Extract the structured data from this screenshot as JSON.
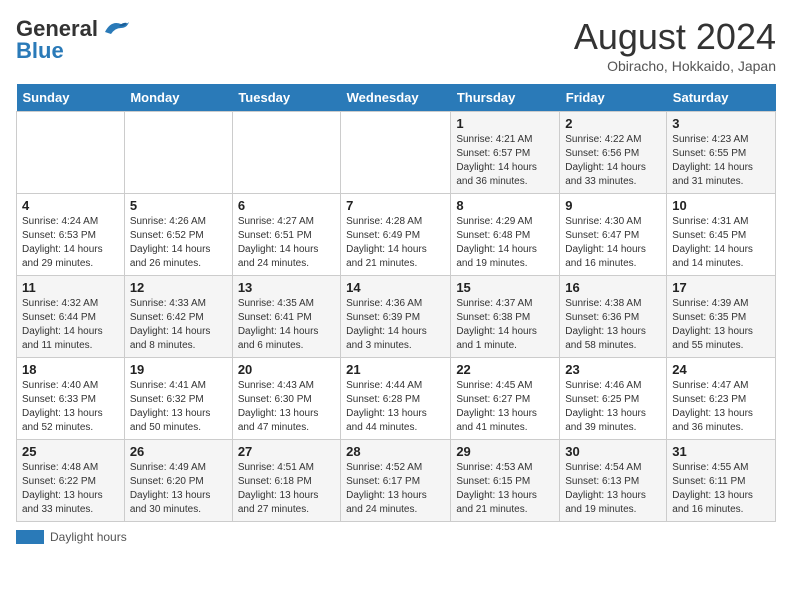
{
  "logo": {
    "line1": "General",
    "line2": "Blue"
  },
  "title": "August 2024",
  "subtitle": "Obiracho, Hokkaido, Japan",
  "weekdays": [
    "Sunday",
    "Monday",
    "Tuesday",
    "Wednesday",
    "Thursday",
    "Friday",
    "Saturday"
  ],
  "legend": {
    "box_label": "Daylight hours"
  },
  "weeks": [
    [
      {
        "day": "",
        "info": ""
      },
      {
        "day": "",
        "info": ""
      },
      {
        "day": "",
        "info": ""
      },
      {
        "day": "",
        "info": ""
      },
      {
        "day": "1",
        "info": "Sunrise: 4:21 AM\nSunset: 6:57 PM\nDaylight: 14 hours\nand 36 minutes."
      },
      {
        "day": "2",
        "info": "Sunrise: 4:22 AM\nSunset: 6:56 PM\nDaylight: 14 hours\nand 33 minutes."
      },
      {
        "day": "3",
        "info": "Sunrise: 4:23 AM\nSunset: 6:55 PM\nDaylight: 14 hours\nand 31 minutes."
      }
    ],
    [
      {
        "day": "4",
        "info": "Sunrise: 4:24 AM\nSunset: 6:53 PM\nDaylight: 14 hours\nand 29 minutes."
      },
      {
        "day": "5",
        "info": "Sunrise: 4:26 AM\nSunset: 6:52 PM\nDaylight: 14 hours\nand 26 minutes."
      },
      {
        "day": "6",
        "info": "Sunrise: 4:27 AM\nSunset: 6:51 PM\nDaylight: 14 hours\nand 24 minutes."
      },
      {
        "day": "7",
        "info": "Sunrise: 4:28 AM\nSunset: 6:49 PM\nDaylight: 14 hours\nand 21 minutes."
      },
      {
        "day": "8",
        "info": "Sunrise: 4:29 AM\nSunset: 6:48 PM\nDaylight: 14 hours\nand 19 minutes."
      },
      {
        "day": "9",
        "info": "Sunrise: 4:30 AM\nSunset: 6:47 PM\nDaylight: 14 hours\nand 16 minutes."
      },
      {
        "day": "10",
        "info": "Sunrise: 4:31 AM\nSunset: 6:45 PM\nDaylight: 14 hours\nand 14 minutes."
      }
    ],
    [
      {
        "day": "11",
        "info": "Sunrise: 4:32 AM\nSunset: 6:44 PM\nDaylight: 14 hours\nand 11 minutes."
      },
      {
        "day": "12",
        "info": "Sunrise: 4:33 AM\nSunset: 6:42 PM\nDaylight: 14 hours\nand 8 minutes."
      },
      {
        "day": "13",
        "info": "Sunrise: 4:35 AM\nSunset: 6:41 PM\nDaylight: 14 hours\nand 6 minutes."
      },
      {
        "day": "14",
        "info": "Sunrise: 4:36 AM\nSunset: 6:39 PM\nDaylight: 14 hours\nand 3 minutes."
      },
      {
        "day": "15",
        "info": "Sunrise: 4:37 AM\nSunset: 6:38 PM\nDaylight: 14 hours\nand 1 minute."
      },
      {
        "day": "16",
        "info": "Sunrise: 4:38 AM\nSunset: 6:36 PM\nDaylight: 13 hours\nand 58 minutes."
      },
      {
        "day": "17",
        "info": "Sunrise: 4:39 AM\nSunset: 6:35 PM\nDaylight: 13 hours\nand 55 minutes."
      }
    ],
    [
      {
        "day": "18",
        "info": "Sunrise: 4:40 AM\nSunset: 6:33 PM\nDaylight: 13 hours\nand 52 minutes."
      },
      {
        "day": "19",
        "info": "Sunrise: 4:41 AM\nSunset: 6:32 PM\nDaylight: 13 hours\nand 50 minutes."
      },
      {
        "day": "20",
        "info": "Sunrise: 4:43 AM\nSunset: 6:30 PM\nDaylight: 13 hours\nand 47 minutes."
      },
      {
        "day": "21",
        "info": "Sunrise: 4:44 AM\nSunset: 6:28 PM\nDaylight: 13 hours\nand 44 minutes."
      },
      {
        "day": "22",
        "info": "Sunrise: 4:45 AM\nSunset: 6:27 PM\nDaylight: 13 hours\nand 41 minutes."
      },
      {
        "day": "23",
        "info": "Sunrise: 4:46 AM\nSunset: 6:25 PM\nDaylight: 13 hours\nand 39 minutes."
      },
      {
        "day": "24",
        "info": "Sunrise: 4:47 AM\nSunset: 6:23 PM\nDaylight: 13 hours\nand 36 minutes."
      }
    ],
    [
      {
        "day": "25",
        "info": "Sunrise: 4:48 AM\nSunset: 6:22 PM\nDaylight: 13 hours\nand 33 minutes."
      },
      {
        "day": "26",
        "info": "Sunrise: 4:49 AM\nSunset: 6:20 PM\nDaylight: 13 hours\nand 30 minutes."
      },
      {
        "day": "27",
        "info": "Sunrise: 4:51 AM\nSunset: 6:18 PM\nDaylight: 13 hours\nand 27 minutes."
      },
      {
        "day": "28",
        "info": "Sunrise: 4:52 AM\nSunset: 6:17 PM\nDaylight: 13 hours\nand 24 minutes."
      },
      {
        "day": "29",
        "info": "Sunrise: 4:53 AM\nSunset: 6:15 PM\nDaylight: 13 hours\nand 21 minutes."
      },
      {
        "day": "30",
        "info": "Sunrise: 4:54 AM\nSunset: 6:13 PM\nDaylight: 13 hours\nand 19 minutes."
      },
      {
        "day": "31",
        "info": "Sunrise: 4:55 AM\nSunset: 6:11 PM\nDaylight: 13 hours\nand 16 minutes."
      }
    ]
  ]
}
